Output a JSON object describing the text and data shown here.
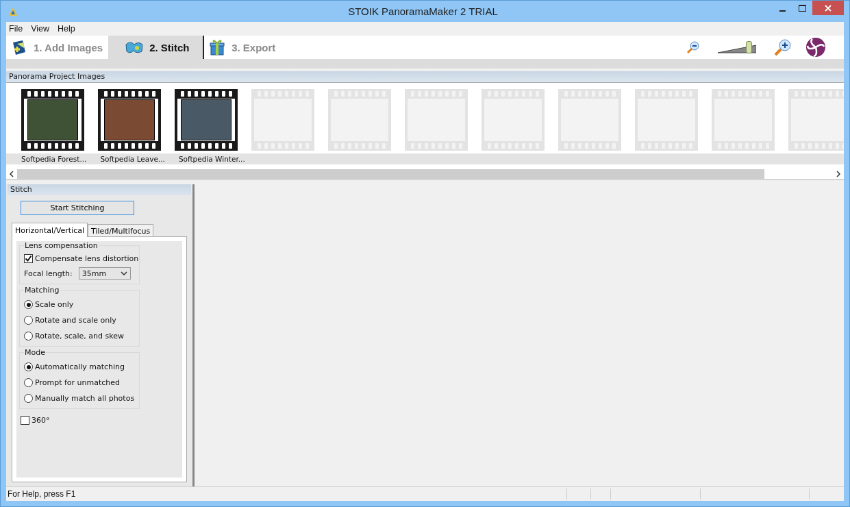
{
  "window": {
    "title": "STOIK PanoramaMaker 2 TRIAL"
  },
  "menu": [
    "File",
    "View",
    "Help"
  ],
  "steps": [
    {
      "label": "1. Add Images",
      "selected": false
    },
    {
      "label": "2. Stitch",
      "selected": true
    },
    {
      "label": "3. Export",
      "selected": false
    }
  ],
  "zoom": {
    "level": 0.8
  },
  "images_panel": {
    "title": "Panorama Project Images",
    "frames": [
      {
        "kind": "photo",
        "caption": "Softpedia Forest...",
        "color": "#3f5236"
      },
      {
        "kind": "photo",
        "caption": "Softpedia Leave...",
        "color": "#7a4a32"
      },
      {
        "kind": "photo",
        "caption": "Softpedia Winter...",
        "color": "#4a5966"
      },
      {
        "kind": "empty"
      },
      {
        "kind": "empty"
      },
      {
        "kind": "empty"
      },
      {
        "kind": "empty"
      },
      {
        "kind": "empty"
      },
      {
        "kind": "empty"
      },
      {
        "kind": "empty"
      },
      {
        "kind": "empty"
      }
    ]
  },
  "stitch_panel": {
    "title": "Stitch",
    "start_button": "Start Stitching",
    "tabs": [
      {
        "label": "Horizontal/Vertical",
        "selected": true
      },
      {
        "label": "Tiled/Multifocus",
        "selected": false
      }
    ],
    "lens": {
      "title": "Lens compensation",
      "checkbox": {
        "label": "Compensate lens distortion",
        "checked": true
      },
      "focal_label": "Focal length:",
      "focal_value": "35mm"
    },
    "groups": [
      {
        "title": "Matching",
        "options": [
          {
            "label": "Scale only",
            "selected": true
          },
          {
            "label": "Rotate and scale only",
            "selected": false
          },
          {
            "label": "Rotate, scale, and skew",
            "selected": false
          }
        ]
      },
      {
        "title": "Mode",
        "options": [
          {
            "label": "Automatically matching",
            "selected": true
          },
          {
            "label": "Prompt for unmatched",
            "selected": false
          },
          {
            "label": "Manually match all photos",
            "selected": false
          }
        ]
      }
    ],
    "full_circle": {
      "label": "360°",
      "checked": false
    }
  },
  "status_bar": "For Help, press F1"
}
